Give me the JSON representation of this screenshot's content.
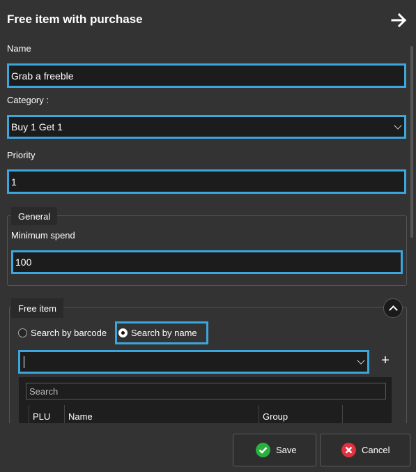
{
  "header": {
    "title": "Free item with purchase",
    "close_icon": "arrow-right-icon"
  },
  "form": {
    "name_label": "Name",
    "name_value": "Grab a freeble",
    "category_label": "Category :",
    "category_value": "Buy 1 Get 1",
    "priority_label": "Priority",
    "priority_value": "1"
  },
  "general": {
    "legend": "General",
    "min_spend_label": "Minimum spend",
    "min_spend_value": "100"
  },
  "free_item": {
    "legend": "Free item",
    "radio_barcode": "Search by barcode",
    "radio_name": "Search by name",
    "selected_radio": "name",
    "item_select_value": "",
    "add_label": "+",
    "search_placeholder": "Search",
    "columns": [
      "PLU",
      "Name",
      "Group",
      ""
    ]
  },
  "footer": {
    "save_label": "Save",
    "cancel_label": "Cancel"
  },
  "colors": {
    "accent": "#3ba6dc",
    "background": "#333333",
    "save_icon": "#27b23e",
    "cancel_icon": "#e0323f"
  }
}
